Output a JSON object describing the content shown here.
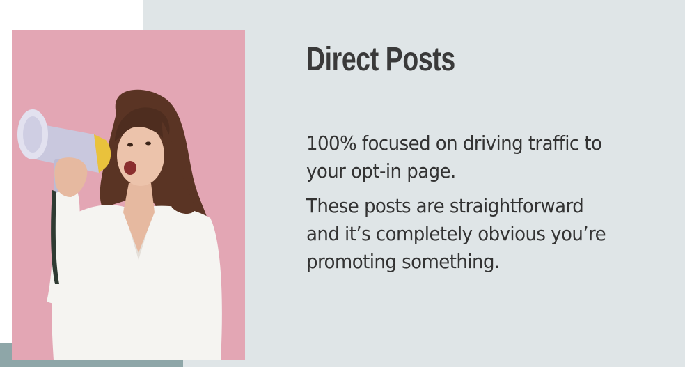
{
  "slide": {
    "title": "Direct Posts",
    "paragraph_1_line_1": "100% focused on driving traffic to",
    "paragraph_1_line_2": "your opt-in page.",
    "paragraph_2_line_1": "These posts are straightforward",
    "paragraph_2_line_2": "and it’s completely obvious you’re",
    "paragraph_2_line_3": "promoting something."
  },
  "colors": {
    "panel_background": "#dfe5e7",
    "photo_background": "#e3a6b4",
    "accent_strip": "#8ea6a8",
    "text": "#333333"
  },
  "image": {
    "subject": "woman-with-megaphone-photo"
  }
}
